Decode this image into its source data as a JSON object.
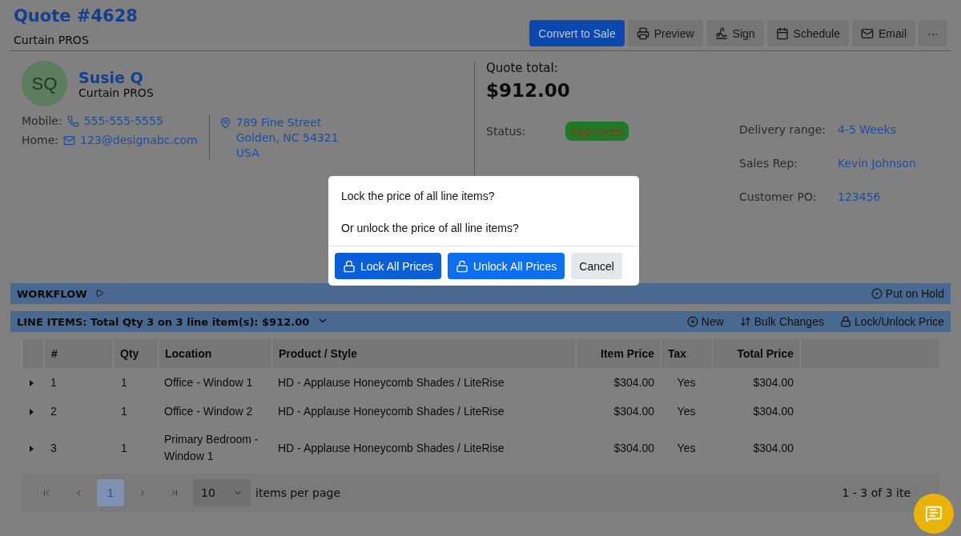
{
  "header": {
    "title": "Quote #4628",
    "company": "Curtain PROS",
    "actions": [
      {
        "kind": "primary",
        "label": "Convert to Sale"
      },
      {
        "kind": "print",
        "label": "Preview"
      },
      {
        "kind": "sign",
        "label": "Sign"
      },
      {
        "kind": "calendar",
        "label": "Schedule"
      },
      {
        "kind": "mail",
        "label": "Email"
      },
      {
        "kind": "more",
        "label": "···"
      }
    ]
  },
  "customer": {
    "initials": "SQ",
    "name": "Susie Q",
    "company": "Curtain PROS",
    "contacts": [
      {
        "label": "Mobile:",
        "kind": "phone",
        "value": "555-555-5555"
      },
      {
        "label": "Home:",
        "kind": "mail",
        "value": "123@designabc.com"
      }
    ],
    "address": [
      "789 Fine Street",
      "Golden, NC 54321",
      "USA"
    ]
  },
  "summary": {
    "total_label": "Quote total:",
    "total": "$912.00",
    "status_label": "Status:",
    "status": "Approved",
    "details": [
      {
        "label": "Delivery range:",
        "value": "4-5 Weeks"
      },
      {
        "label": "Sales Rep:",
        "value": "Kevin Johnson"
      },
      {
        "label": "Customer PO:",
        "value": "123456"
      }
    ]
  },
  "dialog": {
    "lines": [
      "Lock the price of all line items?",
      "Or unlock the price of all line items?"
    ],
    "buttons": [
      {
        "kind": "lock",
        "label": "Lock All Prices"
      },
      {
        "kind": "unlock",
        "label": "Unlock All Prices"
      },
      {
        "kind": "cancel",
        "label": "Cancel"
      }
    ]
  },
  "workflow": {
    "title": "WORKFLOW",
    "expanded": false,
    "action": "Put on Hold"
  },
  "line_items": {
    "title": "LINE ITEMS: Total Qty 3 on 3 line item(s): $912.00",
    "expanded": true,
    "actions": [
      {
        "kind": "new",
        "label": "New"
      },
      {
        "kind": "bulk",
        "label": "Bulk Changes"
      },
      {
        "kind": "lock",
        "label": "Lock/Unlock Price"
      }
    ],
    "columns": [
      "#",
      "Qty",
      "Location",
      "Product / Style",
      "Item Price",
      "Tax",
      "Total Price"
    ],
    "rows": [
      {
        "expanded": false,
        "cells": [
          "1",
          "1",
          "Office - Window 1",
          "HD - Applause Honeycomb Shades / LiteRise",
          "$304.00",
          "Yes",
          "$304.00"
        ]
      },
      {
        "expanded": false,
        "cells": [
          "2",
          "1",
          "Office - Window 2",
          "HD - Applause Honeycomb Shades / LiteRise",
          "$304.00",
          "Yes",
          "$304.00"
        ]
      },
      {
        "expanded": false,
        "cells": [
          "3",
          "1",
          "Primary Bedroom - Window 1",
          "HD - Applause Honeycomb Shades / LiteRise",
          "$304.00",
          "Yes",
          "$304.00"
        ]
      }
    ],
    "pager": {
      "pages": [
        {
          "label": "1",
          "selected": true
        }
      ],
      "page_size": "10",
      "page_size_label": "items per page",
      "range": "1 - 3 of 3 ite"
    }
  }
}
